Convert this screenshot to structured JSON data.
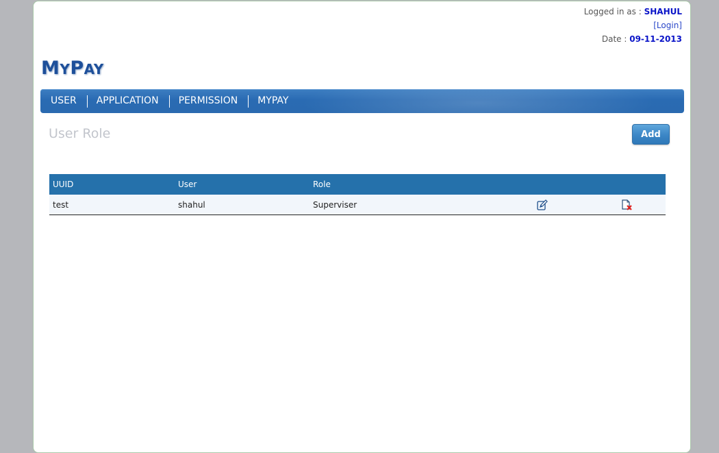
{
  "header": {
    "logged_in_label": "Logged in as : ",
    "username": "SHAHUL",
    "login_link": "[Login]",
    "date_label": "Date : ",
    "date_value": "09-11-2013"
  },
  "logo": {
    "first_big": "M",
    "first_small": "Y",
    "second_big": "P",
    "second_small": "AY"
  },
  "nav": {
    "items": [
      {
        "label": "USER"
      },
      {
        "label": "APPLICATION"
      },
      {
        "label": "PERMISSION"
      },
      {
        "label": "MYPAY"
      }
    ]
  },
  "main": {
    "title": "User Role",
    "add_label": "Add"
  },
  "table": {
    "columns": [
      "UUID",
      "User",
      "Role",
      "",
      ""
    ],
    "rows": [
      {
        "uuid": "test",
        "user": "shahul",
        "role": "Superviser",
        "edit_icon": "edit-icon",
        "delete_icon": "delete-icon"
      }
    ]
  },
  "colors": {
    "accent": "#2571ab",
    "username": "#0a14c8",
    "logo": "#1d4f9a"
  }
}
